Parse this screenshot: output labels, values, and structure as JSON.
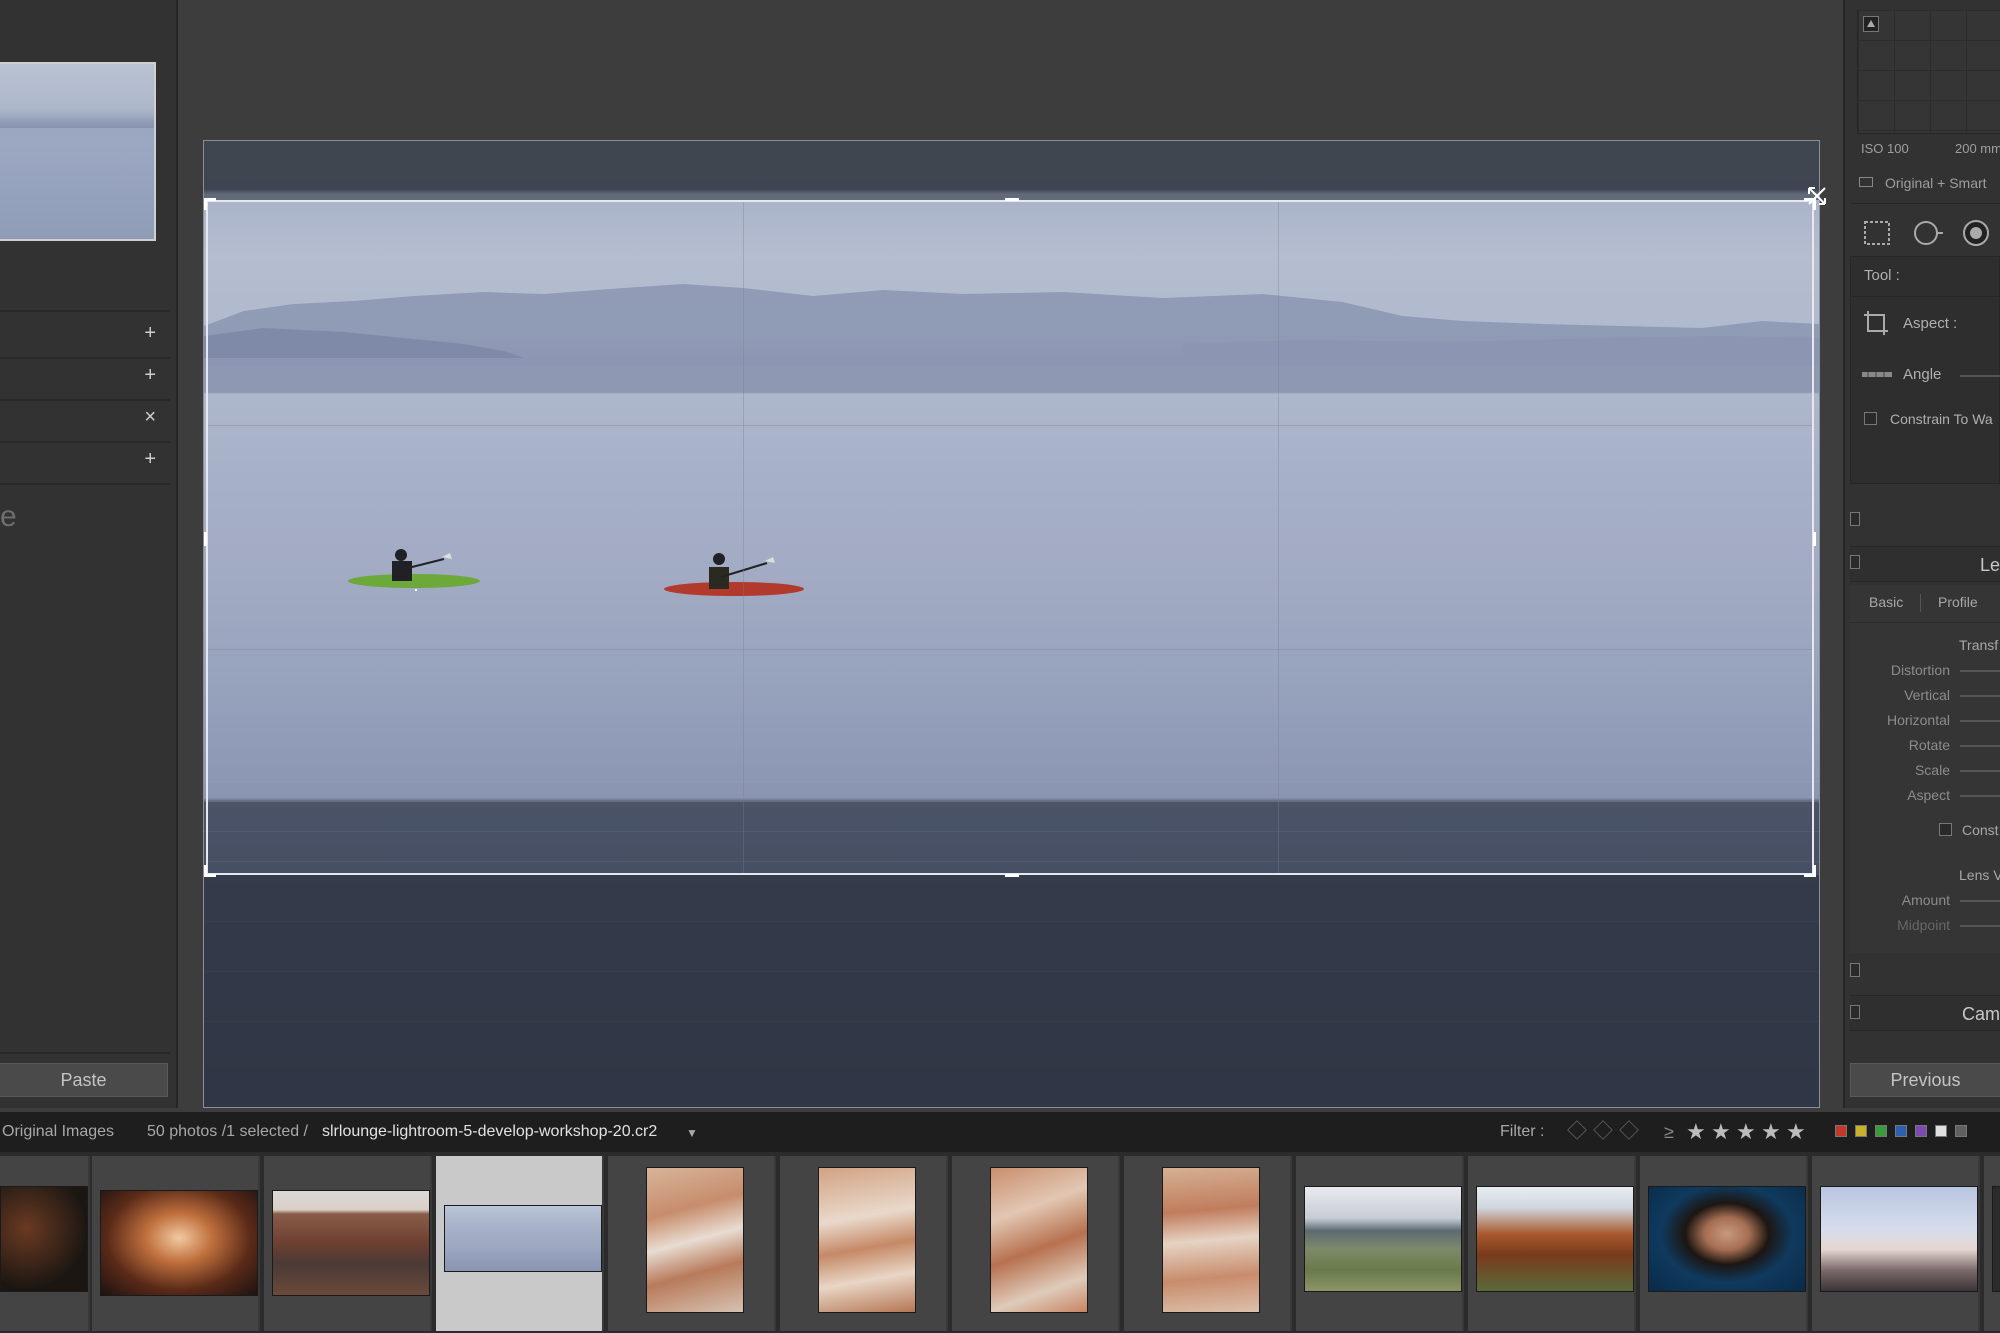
{
  "left_panel": {
    "letter": "e",
    "row_symbols": [
      "+",
      "+",
      "×",
      "+"
    ],
    "paste_label": "Paste"
  },
  "right_panel": {
    "iso": "ISO 100",
    "focal": "200 mm",
    "view_mode": "Original + Smart",
    "tool_label": "Tool :",
    "aspect_label": "Aspect :",
    "angle_label": "Angle",
    "constrain_label": "Constrain To Wa",
    "lens_header": "Le",
    "tabs": [
      "Basic",
      "Profile"
    ],
    "transform_title": "Transf",
    "transform_labels": [
      "Distortion",
      "Vertical",
      "Horizontal",
      "Rotate",
      "Scale",
      "Aspect"
    ],
    "constrain2_label": "Const",
    "lens_vignette_title": "Lens V",
    "vignette_labels": [
      "Amount",
      "Midpoint"
    ],
    "camera_header": "Cam",
    "previous_label": "Previous"
  },
  "filmstrip_bar": {
    "source": "Original Images",
    "count": "50 photos /1 selected /",
    "filename": "slrlounge-lightroom-5-develop-workshop-20.cr2",
    "filter_label": "Filter :",
    "gte": "≥",
    "stars": [
      "★",
      "★",
      "★",
      "★",
      "★"
    ],
    "color_labels": [
      "#c0392b",
      "#c9b22a",
      "#3b9a3b",
      "#2f5fb3",
      "#7b4bb0",
      "#e0e0e0",
      "#606060"
    ]
  },
  "filmstrip": {
    "selected_index": 3,
    "thumbs": [
      "slot-canyon-dark",
      "antelope-canyon",
      "horseshoe-bend",
      "kayakers-lake",
      "bryce-hoodoos-1",
      "bryce-hoodoos-2",
      "bryce-hoodoos-3",
      "bryce-hoodoos-4",
      "wedding-coast",
      "zion-cliffs",
      "portrait-woman",
      "couple-sunset"
    ]
  }
}
